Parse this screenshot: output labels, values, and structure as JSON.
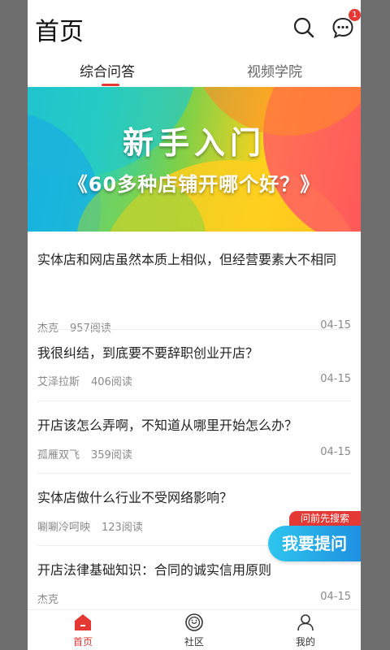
{
  "header": {
    "title": "首页",
    "search_icon": "search-icon",
    "message_icon": "chat-bubble-icon",
    "badge_count": "1"
  },
  "tabs": [
    {
      "label": "综合问答",
      "active": true
    },
    {
      "label": "视频学院",
      "active": false
    }
  ],
  "banner": {
    "title": "新手入门",
    "subtitle": "《60多种店铺开哪个好？》"
  },
  "list": [
    {
      "title": "实体店和网店虽然本质上相似，但经营要素大不相同",
      "author": "杰克",
      "reads": "957阅读",
      "date": "04-15"
    },
    {
      "title": "我很纠结，到底要不要辞职创业开店？",
      "author": "艾泽拉斯",
      "reads": "406阅读",
      "date": "04-15"
    },
    {
      "title": "开店该怎么弄啊，不知道从哪里开始怎么办？",
      "author": "孤雁双飞",
      "reads": "359阅读",
      "date": "04-15"
    },
    {
      "title": "实体店做什么行业不受网络影响？",
      "author": "唰唰冷呵映",
      "reads": "123阅读",
      "date": ""
    },
    {
      "title": "开店法律基础知识：合同的诚实信用原则",
      "author": "杰克",
      "reads": "",
      "date": "04-15"
    }
  ],
  "ask": {
    "tag": "问前先搜索",
    "button": "我要提问"
  },
  "nav": [
    {
      "label": "首页",
      "icon": "home-icon",
      "active": true
    },
    {
      "label": "社区",
      "icon": "community-icon",
      "active": false
    },
    {
      "label": "我的",
      "icon": "user-icon",
      "active": false
    }
  ],
  "colors": {
    "accent": "#e53935",
    "ask_button": "#1e90e0"
  }
}
